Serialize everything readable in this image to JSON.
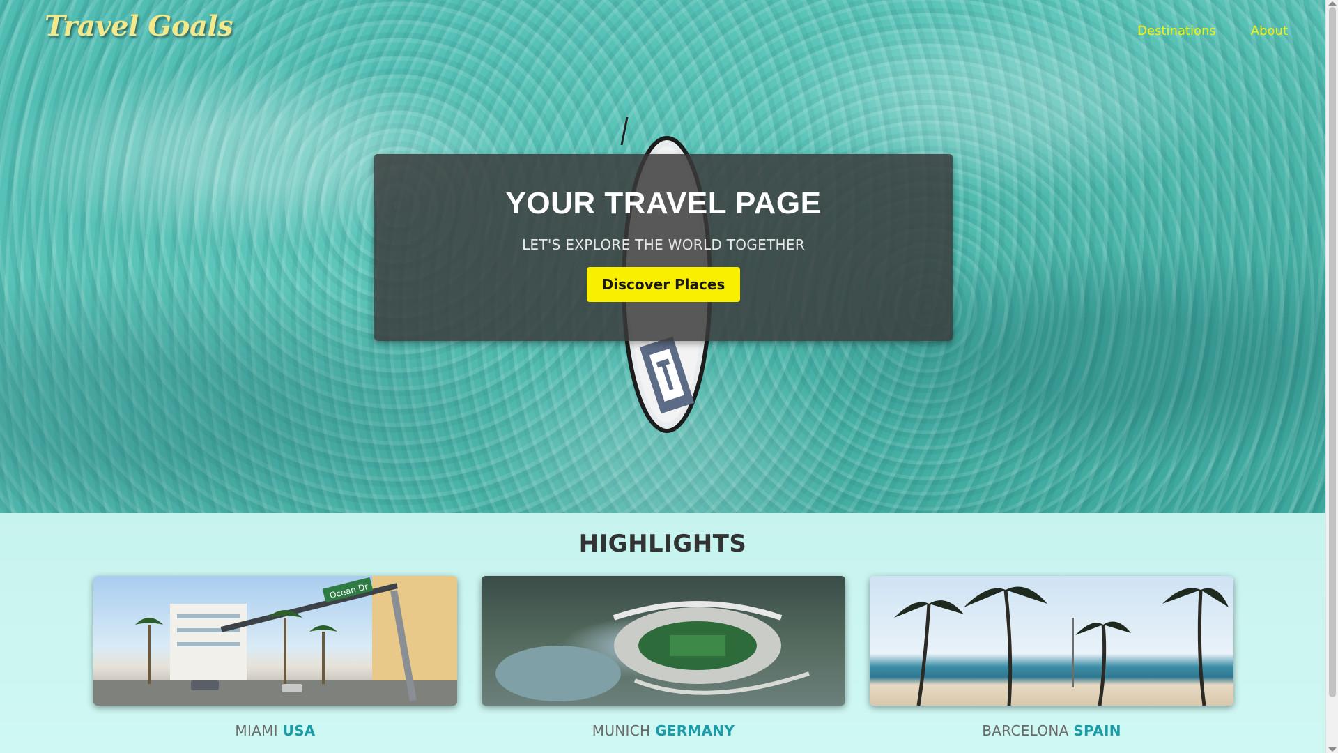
{
  "nav": {
    "logo": "Travel Goals",
    "links": [
      {
        "label": "Destinations"
      },
      {
        "label": "About"
      }
    ]
  },
  "hero": {
    "title": "YOUR TRAVEL PAGE",
    "subtitle": "LET'S EXPLORE THE WORLD TOGETHER",
    "button_label": "Discover Places"
  },
  "highlights": {
    "title": "HIGHLIGHTS",
    "cards": [
      {
        "city": "MIAMI",
        "country": "USA",
        "street_sign": "Ocean Dr"
      },
      {
        "city": "MUNICH",
        "country": "GERMANY"
      },
      {
        "city": "BARCELONA",
        "country": "SPAIN"
      }
    ]
  },
  "colors": {
    "accent_yellow": "#f8f000",
    "logo": "#f4e98a",
    "country_teal": "#1b9aa8",
    "highlights_bg": "#c8f6f2"
  }
}
